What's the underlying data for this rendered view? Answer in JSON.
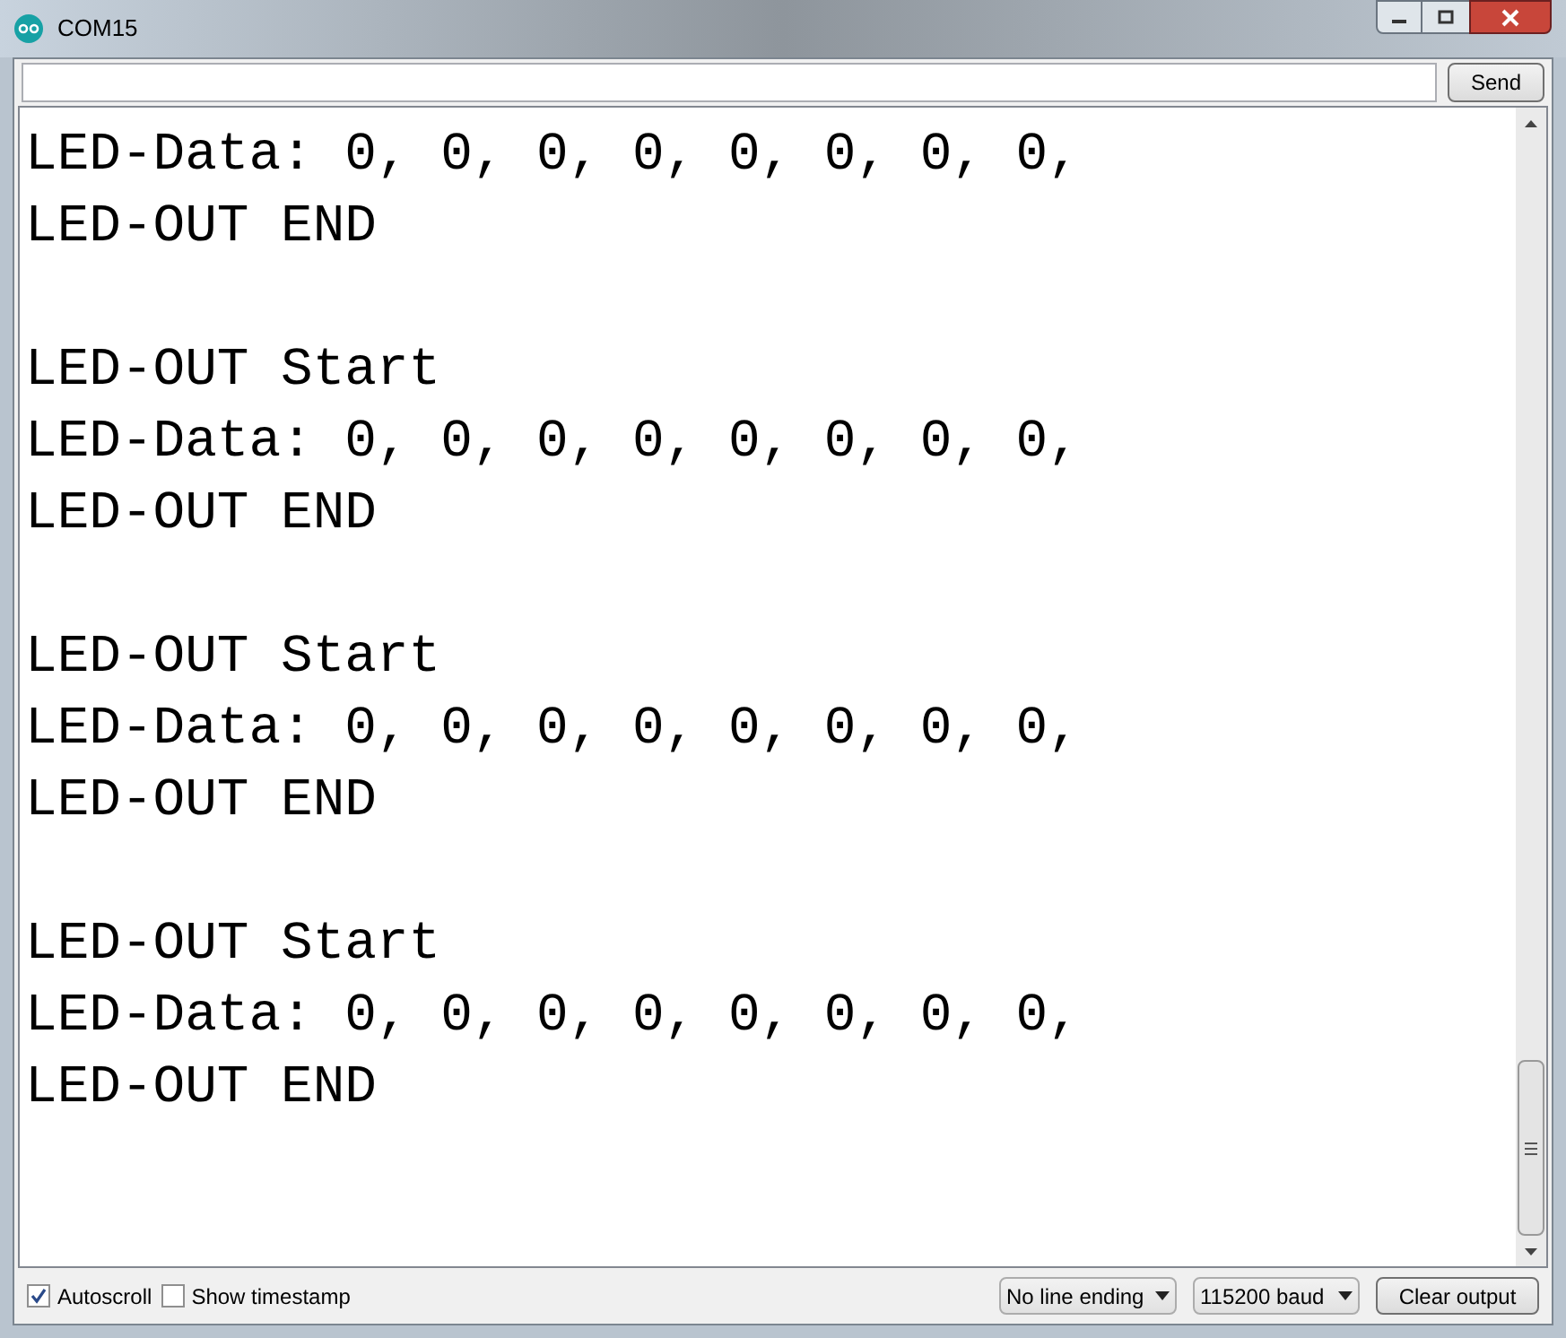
{
  "window": {
    "title": "COM15"
  },
  "send_button": "Send",
  "output": {
    "blocks": [
      {
        "lines": [
          "LED-Data: 0, 0, 0, 0, 0, 0, 0, 0,",
          "LED-OUT END"
        ]
      },
      {
        "lines": [
          "LED-OUT Start",
          "LED-Data: 0, 0, 0, 0, 0, 0, 0, 0,",
          "LED-OUT END"
        ]
      },
      {
        "lines": [
          "LED-OUT Start",
          "LED-Data: 0, 0, 0, 0, 0, 0, 0, 0,",
          "LED-OUT END"
        ]
      },
      {
        "lines": [
          "LED-OUT Start",
          "LED-Data: 0, 0, 0, 0, 0, 0, 0, 0,",
          "LED-OUT END"
        ]
      }
    ]
  },
  "options": [
    {
      "label": "Autoscroll",
      "checked": true
    },
    {
      "label": "Show timestamp",
      "checked": false
    }
  ],
  "dropdowns": [
    "No line ending",
    "115200 baud"
  ],
  "clear_button": "Clear output"
}
